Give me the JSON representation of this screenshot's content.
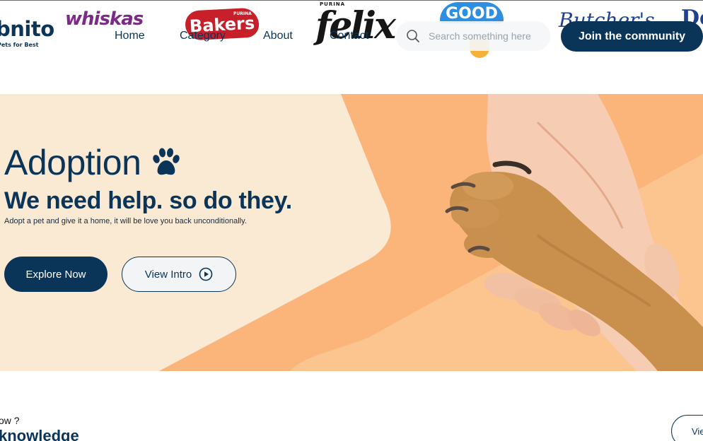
{
  "brand_strip": {
    "bonito": "bnito",
    "bonito_tagline": "Pets for Best",
    "whiskas": "whiskas",
    "bakers": "Bakers",
    "bakers_purina": "PURINA",
    "felix": "felix",
    "felix_purina": "PURINA",
    "good": "GOOD",
    "butchers": "Butcher's",
    "edge": "De"
  },
  "nav": {
    "links": [
      "Home",
      "Category",
      "About",
      "Contact"
    ]
  },
  "search": {
    "placeholder": "Search something here",
    "icon": "search-icon"
  },
  "cta": {
    "join_label": "Join the community"
  },
  "hero": {
    "title": "Adoption",
    "title_icon": "paw-icon",
    "subtitle": "We need help. so do they.",
    "description": "Adopt a pet and give it a home, it will be love you back unconditionally.",
    "explore_label": "Explore Now",
    "intro_label": "View Intro",
    "intro_icon": "play-circle-icon"
  },
  "section_next": {
    "eyebrow": "ow ?",
    "heading": "knowledge",
    "button_label": "Vie"
  },
  "colors": {
    "navy": "#0b3558",
    "cream": "#fae9d3",
    "orange": "#fbb57a",
    "white": "#ffffff"
  }
}
